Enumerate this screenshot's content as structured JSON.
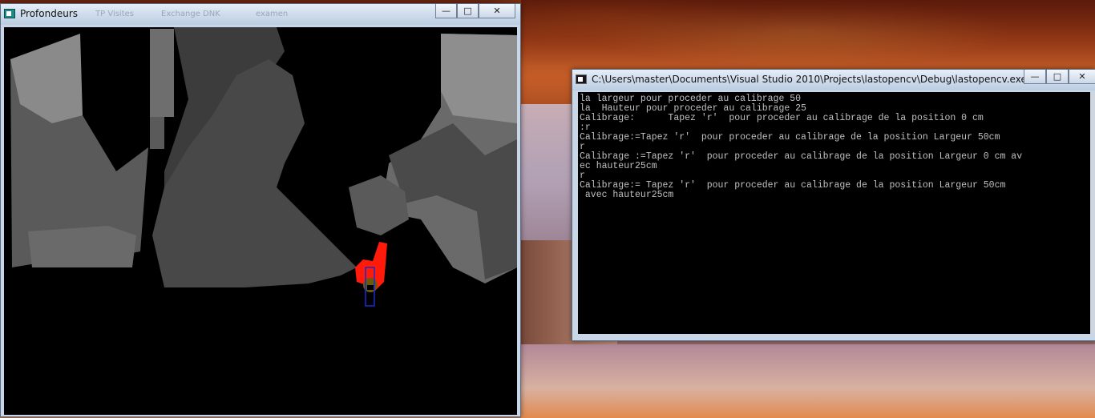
{
  "depth_window": {
    "title": "Profondeurs",
    "ghost_titles": [
      "TP Visites",
      "Exchange DNK",
      "examen"
    ],
    "controls": {
      "minimize": "—",
      "maximize": "□",
      "close": "✕"
    }
  },
  "console_window": {
    "title": "C:\\Users\\master\\Documents\\Visual Studio 2010\\Projects\\lastopencv\\Debug\\lastopencv.exe",
    "controls": {
      "minimize": "—",
      "maximize": "□",
      "close": "✕"
    },
    "lines": [
      "la largeur pour proceder au calibrage 50",
      "la  Hauteur pour proceder au calibrage 25",
      "Calibrage:      Tapez 'r'  pour proceder au calibrage de la position 0 cm",
      ":r",
      "Calibrage:=Tapez 'r'  pour proceder au calibrage de la position Largeur 50cm",
      "r",
      "Calibrage :=Tapez 'r'  pour proceder au calibrage de la position Largeur 0 cm av",
      "ec hauteur25cm",
      "r",
      "Calibrage:= Tapez 'r'  pour proceder au calibrage de la position Largeur 50cm",
      " avec hauteur25cm"
    ]
  },
  "colors": {
    "depth_background": "#000000",
    "tracked_blob": "#ff1a0a",
    "tracked_marker": "#6a5a0a",
    "tracking_box": "#1a2ad0",
    "console_text": "#c0c0c0"
  }
}
